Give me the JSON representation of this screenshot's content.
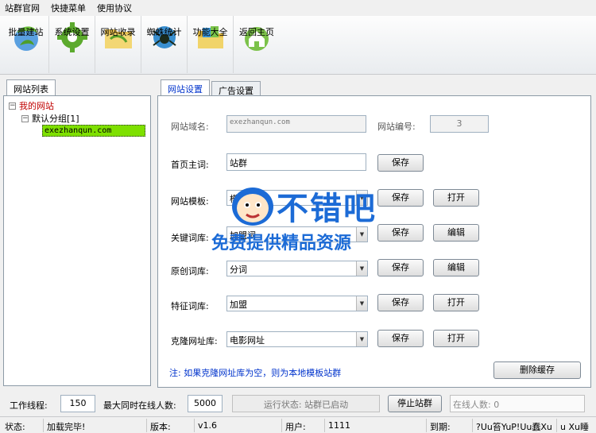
{
  "menu": [
    "站群官网",
    "快捷菜单",
    "使用协议"
  ],
  "toolbar": {
    "buttons": [
      {
        "label": "批量建站",
        "icon": "leaf-globe-icon"
      },
      {
        "label": "系统设置",
        "icon": "gear-icon"
      },
      {
        "label": "网站收录",
        "icon": "folder-icon"
      },
      {
        "label": "蜘蛛统计",
        "icon": "spider-icon"
      },
      {
        "label": "功能大全",
        "icon": "folder-files-icon"
      },
      {
        "label": "返回主页",
        "icon": "home-icon"
      }
    ]
  },
  "left": {
    "tab": "网站列表",
    "tree": {
      "root": "我的网站",
      "group": "默认分组[1]",
      "site": "exezhanqun.com"
    }
  },
  "right": {
    "tabs": [
      "网站设置",
      "广告设置"
    ],
    "fields": {
      "domain_label": "网站域名:",
      "domain_value": "exezhanqun.com",
      "number_label": "网站编号:",
      "number_value": "3",
      "keyword_label": "首页主词:",
      "keyword_value": "站群",
      "template_label": "网站模板:",
      "template_value": "模板",
      "kw_lib_label": "关键词库:",
      "kw_lib_value": "加盟词",
      "orig_lib_label": "原创词库:",
      "orig_lib_value": "分词",
      "feature_lib_label": "特征词库:",
      "feature_lib_value": "加盟",
      "clone_label": "克隆网址库:",
      "clone_value": "电影网址"
    },
    "buttons": {
      "save": "保存",
      "open": "打开",
      "edit": "编辑",
      "clear_cache": "删除缓存"
    },
    "note": "注: 如果克隆网址库为空，则为本地模板站群"
  },
  "bottom": {
    "threads_label": "工作线程:",
    "threads_value": "150",
    "max_online_label": "最大同时在线人数:",
    "max_online_value": "5000",
    "run_status": "运行状态: 站群已启动",
    "stop_button": "停止站群",
    "online_count": "在线人数: 0"
  },
  "status": {
    "state_label": "状态:",
    "state_value": "加载完毕!",
    "version_label": "版本:",
    "version_value": "v1.6",
    "user_label": "用户:",
    "user_value": "1111",
    "expire_label": "到期:",
    "expire_value": "?Uu笞YuP!Uu蠢Xu",
    "extra": "u​​​ Xu睡"
  },
  "watermark": {
    "title": "不错吧",
    "subtitle": "免费提供精品资源"
  }
}
